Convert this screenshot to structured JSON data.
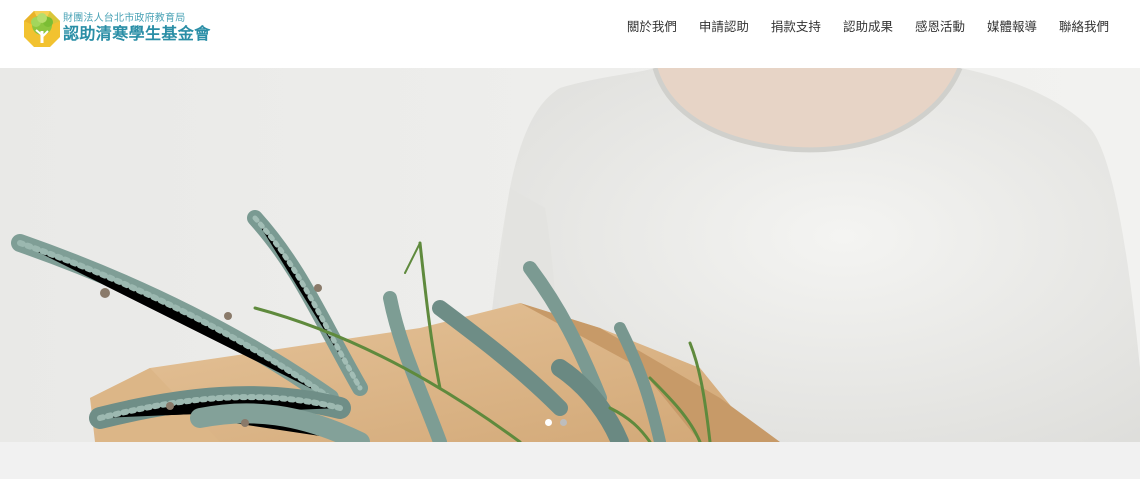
{
  "brand": {
    "subtitle": "財團法人台北市政府教育局",
    "name": "認助清寒學生基金會"
  },
  "nav": {
    "items": [
      {
        "label": "關於我們"
      },
      {
        "label": "申請認助"
      },
      {
        "label": "捐款支持"
      },
      {
        "label": "認助成果"
      },
      {
        "label": "感恩活動"
      },
      {
        "label": "媒體報導"
      },
      {
        "label": "聯絡我們"
      }
    ]
  },
  "slider": {
    "slide_count": 2,
    "active_slide": 1
  },
  "colors": {
    "brand_teal": "#2a8ea6",
    "nav_text": "#333333",
    "dot_active": "#ffffff",
    "dot_inactive": "#bdbdbd"
  }
}
